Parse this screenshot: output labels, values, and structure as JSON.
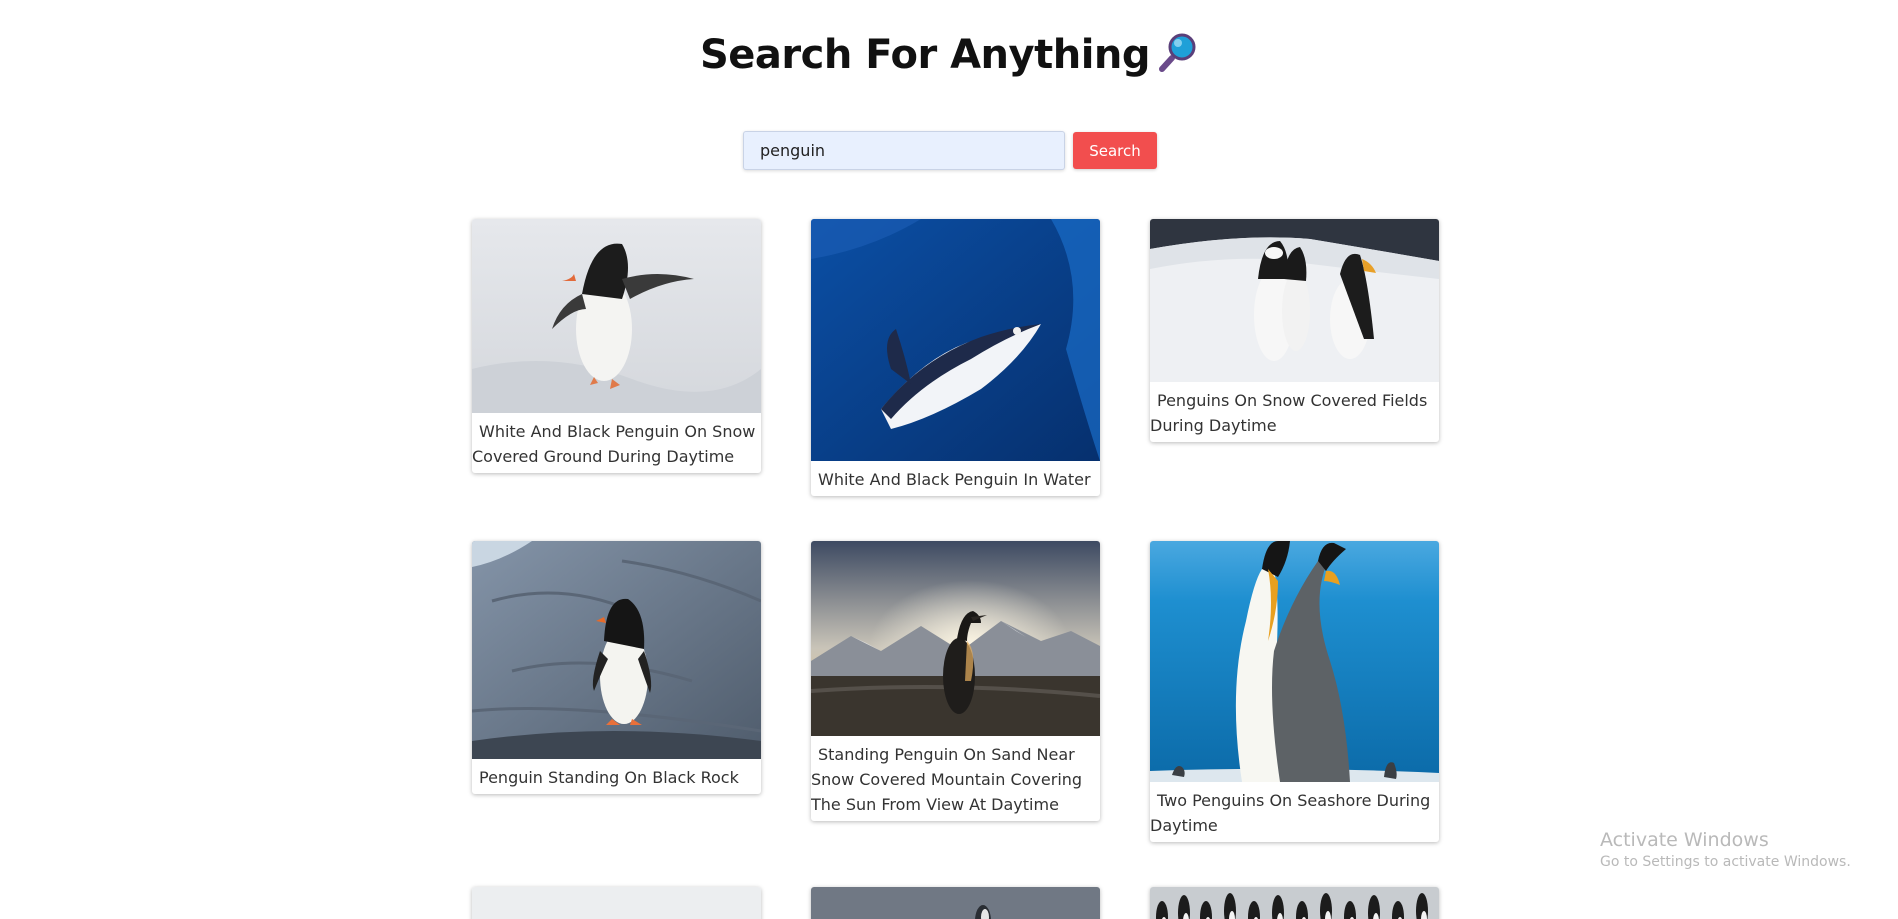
{
  "header": {
    "title": "Search For Anything",
    "icon": "magnifying-glass-icon"
  },
  "search": {
    "value": "penguin",
    "button_label": "Search",
    "button_color": "#f24e4e",
    "input_bg": "#e8f0fe"
  },
  "results": [
    {
      "caption": "White And Black Penguin On Snow Covered Ground During Daytime",
      "scene": "penguin-on-snow"
    },
    {
      "caption": "White And Black Penguin In Water",
      "scene": "penguin-underwater"
    },
    {
      "caption": "Penguins On Snow Covered Fields During Daytime",
      "scene": "penguins-on-snowfield"
    },
    {
      "caption": "Penguin Standing On Black Rock",
      "scene": "penguin-on-rock"
    },
    {
      "caption": "Standing Penguin On Sand Near Snow Covered Mountain Covering The Sun From View At Daytime",
      "scene": "penguin-sunset-mountains"
    },
    {
      "caption": "Two Penguins On Seashore During Daytime",
      "scene": "king-penguins-sea"
    },
    {
      "caption": "",
      "scene": "snow-partial"
    },
    {
      "caption": "",
      "scene": "grey-partial"
    },
    {
      "caption": "",
      "scene": "colony-partial"
    }
  ],
  "watermark": {
    "line1": "Activate Windows",
    "line2": "Go to Settings to activate Windows."
  }
}
